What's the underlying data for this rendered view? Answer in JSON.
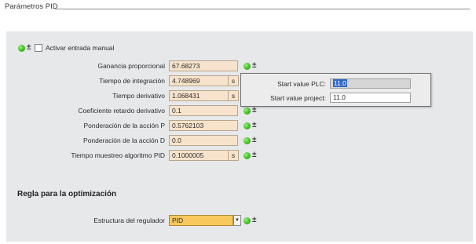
{
  "section": {
    "title": "Parámetros PID"
  },
  "manual": {
    "label": "Activar entrada manual",
    "checked": false
  },
  "params": [
    {
      "label": "Ganancia proporcional",
      "value": "67.68273",
      "unit": ""
    },
    {
      "label": "Tiempo de integración",
      "value": "4.748969",
      "unit": "s"
    },
    {
      "label": "Tiempo derivativo",
      "value": "1.068431",
      "unit": "s"
    },
    {
      "label": "Coeficiente retardo derivativo",
      "value": "0.1",
      "unit": ""
    },
    {
      "label": "Ponderación de la acción P",
      "value": "0.5762103",
      "unit": ""
    },
    {
      "label": "Ponderación de la acción D",
      "value": "0.0",
      "unit": ""
    },
    {
      "label": "Tiempo muestreo algoritmo PID",
      "value": "0.1000005",
      "unit": "s"
    }
  ],
  "popup": {
    "plc_label": "Start value PLC:",
    "plc_value": "11.0",
    "project_label": "Start value project:",
    "project_value": "11.0"
  },
  "optimization": {
    "heading": "Regla para la optimización",
    "structure_label": "Estructura del regulador",
    "structure_value": "PID"
  },
  "status": {
    "ok_icon": "green-status-icon",
    "pm_symbol": "±",
    "dropdown_arrow": "▾"
  },
  "colors": {
    "field_bg": "#f7e3cb",
    "dropdown_bg": "#f7c85c",
    "status_green": "#3fbf1f",
    "selection": "#3169c6"
  }
}
